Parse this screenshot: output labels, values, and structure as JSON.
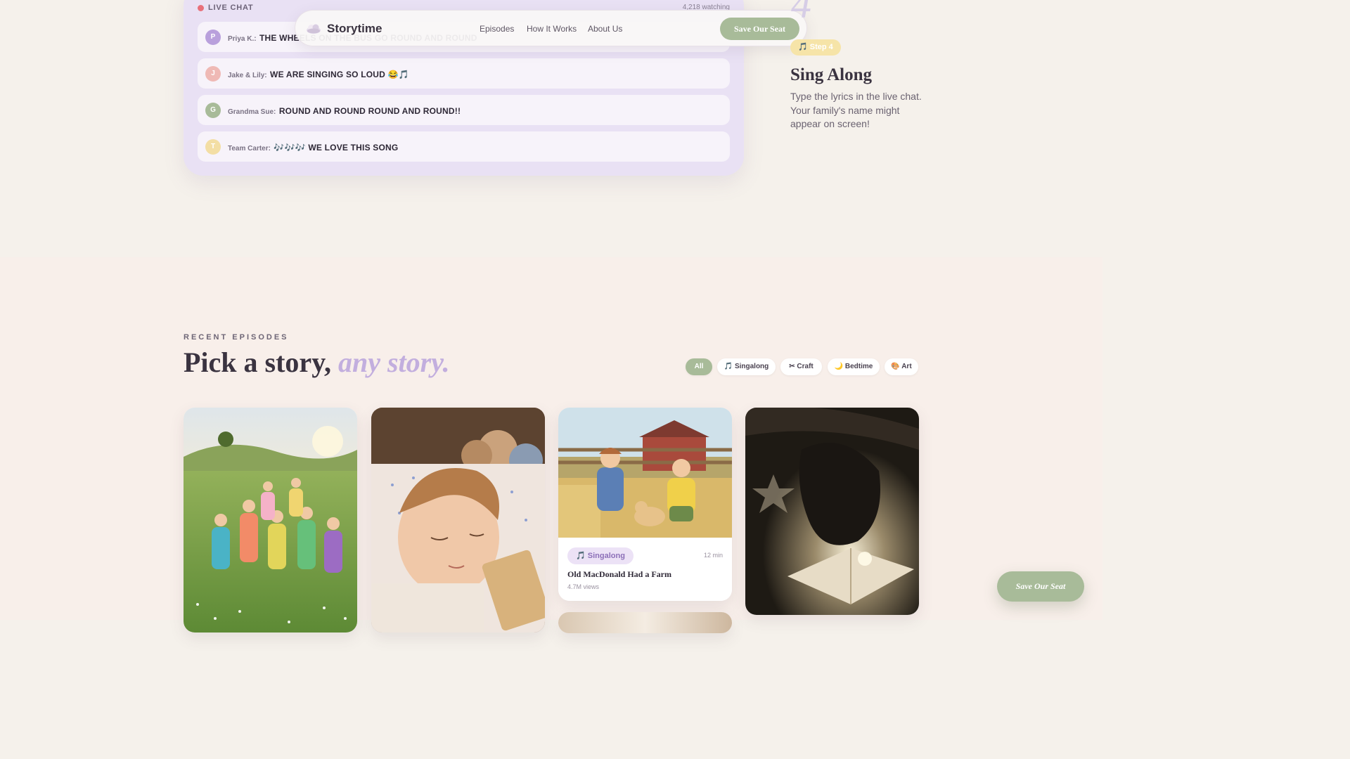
{
  "chat": {
    "live_label": "LIVE CHAT",
    "watching": "4,218 watching",
    "messages": [
      {
        "initial": "P",
        "color": "#b9a0dc",
        "user": "Priya K.:",
        "text": "THE WHEELS ON THE BUS GO ROUND AND ROUND"
      },
      {
        "initial": "J",
        "color": "#efb9b5",
        "user": "Jake & Lily:",
        "text": "WE ARE SINGING SO LOUD 😂🎵"
      },
      {
        "initial": "G",
        "color": "#a8bb99",
        "user": "Grandma Sue:",
        "text": "ROUND AND ROUND ROUND AND ROUND!!"
      },
      {
        "initial": "T",
        "color": "#f3dea4",
        "user": "Team Carter:",
        "text": "🎶🎶🎶 WE LOVE THIS SONG"
      }
    ]
  },
  "nav": {
    "brand": "Storytime",
    "links": [
      "Episodes",
      "How It Works",
      "About Us"
    ],
    "cta": "Save Our Seat"
  },
  "step": {
    "number": "4",
    "pill": "🎵 Step 4",
    "title": "Sing Along",
    "description": "Type the lyrics in the live chat. Your family's name might appear on screen!"
  },
  "episodes": {
    "eyebrow": "RECENT EPISODES",
    "headline": "Pick a story,",
    "headline_accent": "any story.",
    "filters": [
      {
        "label": "All",
        "active": true
      },
      {
        "label": "🎵 Singalong",
        "active": false
      },
      {
        "label": "✂ Craft",
        "active": false
      },
      {
        "label": "🌙 Bedtime",
        "active": false
      },
      {
        "label": "🎨 Art",
        "active": false
      }
    ],
    "featured_card": {
      "tag": "🎵 Singalong",
      "duration": "12 min",
      "title": "Old MacDonald Had a Farm",
      "views": "4.7M views"
    }
  },
  "floating_cta": "Save Our Seat",
  "colors": {
    "sage": "#a8bb99",
    "lavender": "#c2aede",
    "live_red": "#e8707a",
    "butter": "#f6e4a8"
  }
}
